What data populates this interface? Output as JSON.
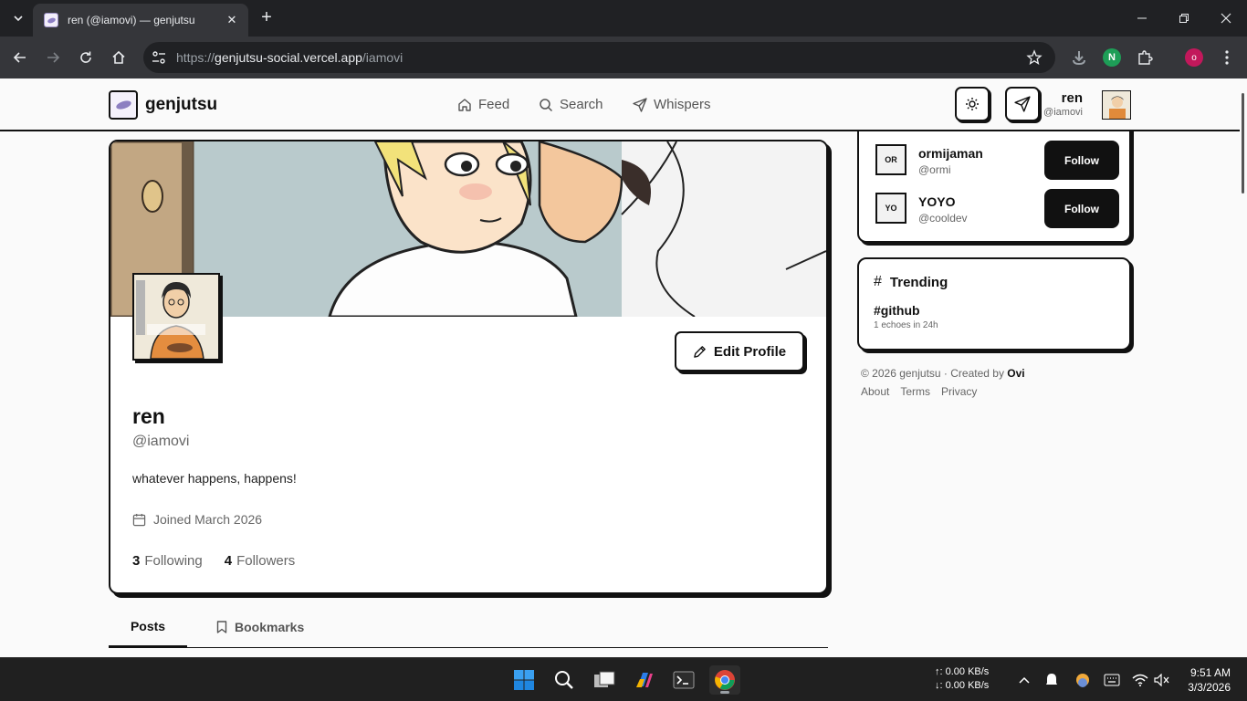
{
  "browser": {
    "tab_title": "ren (@iamovi) — genjutsu",
    "close_tab": "✕",
    "new_tab": "+",
    "url_scheme": "https://",
    "url_host": "genjutsu-social.vercel.app",
    "url_path": "/iamovi",
    "extension_n": "N",
    "profile_initial": "o"
  },
  "header": {
    "logo_text": "genjutsu",
    "nav": [
      {
        "label": "Feed",
        "icon": "home-icon"
      },
      {
        "label": "Search",
        "icon": "search-icon"
      },
      {
        "label": "Whispers",
        "icon": "send-icon"
      }
    ],
    "user_name": "ren",
    "user_handle": "@iamovi"
  },
  "profile": {
    "name": "ren",
    "handle": "@iamovi",
    "bio": "whatever happens, happens!",
    "joined": "Joined March 2026",
    "edit_label": "Edit Profile",
    "following_count": "3",
    "following_label": "Following",
    "followers_count": "4",
    "followers_label": "Followers"
  },
  "tabs": {
    "posts": "Posts",
    "bookmarks": "Bookmarks"
  },
  "suggestions": [
    {
      "initials": "OR",
      "name": "ormijaman",
      "handle": "@ormi",
      "action": "Follow"
    },
    {
      "initials": "YO",
      "name": "YOYO",
      "handle": "@cooldev",
      "action": "Follow"
    }
  ],
  "trending": {
    "title": "Trending",
    "tag": "#github",
    "count": "1 echoes in 24h"
  },
  "footer": {
    "copy": "© 2026 genjutsu · Created by ",
    "creator": "Ovi",
    "links": [
      "About",
      "Terms",
      "Privacy"
    ]
  },
  "taskbar": {
    "net_up": "↑: 0.00 KB/s",
    "net_down": "↓: 0.00 KB/s",
    "time": "9:51 AM",
    "date": "3/3/2026"
  },
  "colors": {
    "accent": "#111111",
    "logo_purple": "#8c7fc1",
    "browser_dark": "#202124"
  }
}
